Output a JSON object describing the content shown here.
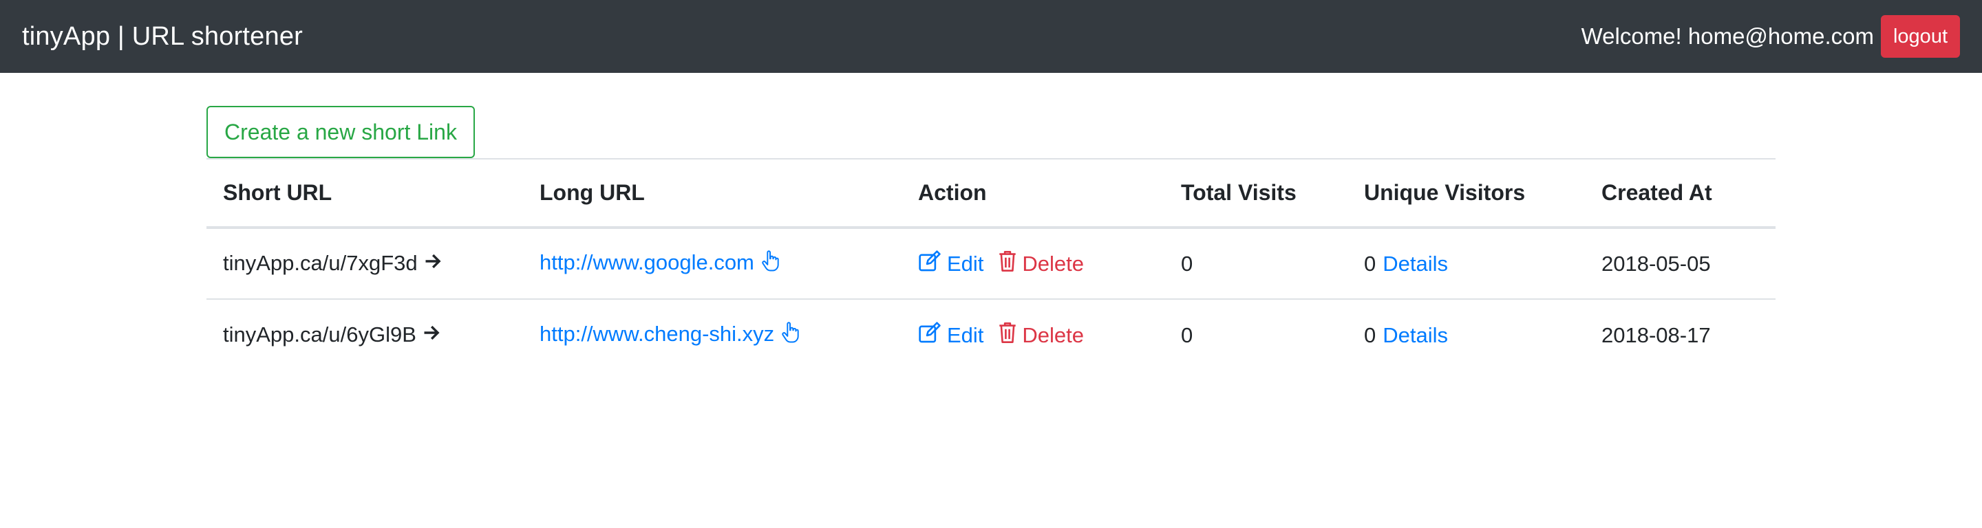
{
  "navbar": {
    "brand": "tinyApp | URL shortener",
    "welcome": "Welcome! home@home.com",
    "logout_label": "logout"
  },
  "main": {
    "create_label": "Create a new short Link",
    "table": {
      "headers": {
        "short_url": "Short URL",
        "long_url": "Long URL",
        "action": "Action",
        "total_visits": "Total Visits",
        "unique_visitors": "Unique Visitors",
        "created_at": "Created At"
      },
      "rows": [
        {
          "short_url": "tinyApp.ca/u/7xgF3d",
          "long_url": "http://www.google.com",
          "edit_label": "Edit",
          "delete_label": "Delete",
          "total_visits": "0",
          "unique_visitors": "0",
          "details_label": "Details",
          "created_at": "2018-05-05"
        },
        {
          "short_url": "tinyApp.ca/u/6yGl9B",
          "long_url": "http://www.cheng-shi.xyz",
          "edit_label": "Edit",
          "delete_label": "Delete",
          "total_visits": "0",
          "unique_visitors": "0",
          "details_label": "Details",
          "created_at": "2018-08-17"
        }
      ]
    }
  },
  "icons": {
    "arrow": "arrow-right-icon",
    "pointer": "hand-pointer-icon",
    "edit": "edit-icon",
    "delete": "trash-icon"
  },
  "colors": {
    "navbar_bg": "#343a40",
    "primary": "#007bff",
    "success": "#28a745",
    "danger": "#dc3545"
  }
}
